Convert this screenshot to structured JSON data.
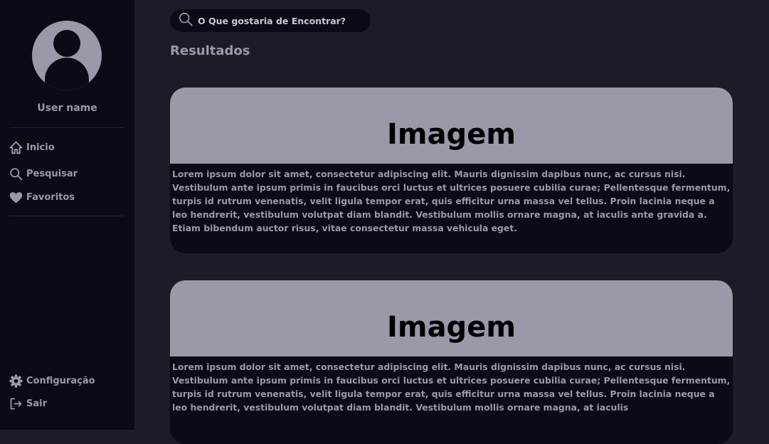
{
  "sidebar": {
    "username": "User name",
    "nav": [
      {
        "label": "Inicio",
        "icon": "home-icon"
      },
      {
        "label": "Pesquisar",
        "icon": "search-icon"
      },
      {
        "label": "Favoritos",
        "icon": "heart-icon"
      }
    ],
    "bottom": [
      {
        "label": "Configuração",
        "icon": "gear-icon"
      },
      {
        "label": "Sair",
        "icon": "logout-icon"
      }
    ]
  },
  "search": {
    "placeholder": "O Que gostaria de Encontrar?"
  },
  "results": {
    "heading": "Resultados",
    "cards": [
      {
        "image_label": "Imagem",
        "text": "Lorem ipsum dolor sit amet, consectetur adipiscing elit. Mauris dignissim dapibus nunc, ac cursus nisi. Vestibulum ante ipsum primis in faucibus orci luctus et ultrices posuere cubilia curae; Pellentesque fermentum, turpis id rutrum venenatis, velit ligula tempor erat, quis efficitur urna massa vel tellus. Proin lacinia neque a leo hendrerit, vestibulum volutpat diam blandit. Vestibulum mollis ornare magna, at iaculis ante gravida a. Etiam bibendum auctor risus, vitae consectetur massa vehicula eget."
      },
      {
        "image_label": "Imagem",
        "text": "Lorem ipsum dolor sit amet, consectetur adipiscing elit. Mauris dignissim dapibus nunc, ac cursus nisi. Vestibulum ante ipsum primis in faucibus orci luctus et ultrices posuere cubilia curae; Pellentesque fermentum, turpis id rutrum venenatis, velit ligula tempor erat, quis efficitur urna massa vel tellus. Proin lacinia neque a leo hendrerit, vestibulum volutpat diam blandit. Vestibulum mollis ornare magna, at iaculis"
      }
    ]
  },
  "colors": {
    "sidebar_bg": "#0b0a16",
    "main_bg": "#1d1b25",
    "accent": "#9b98aa"
  }
}
